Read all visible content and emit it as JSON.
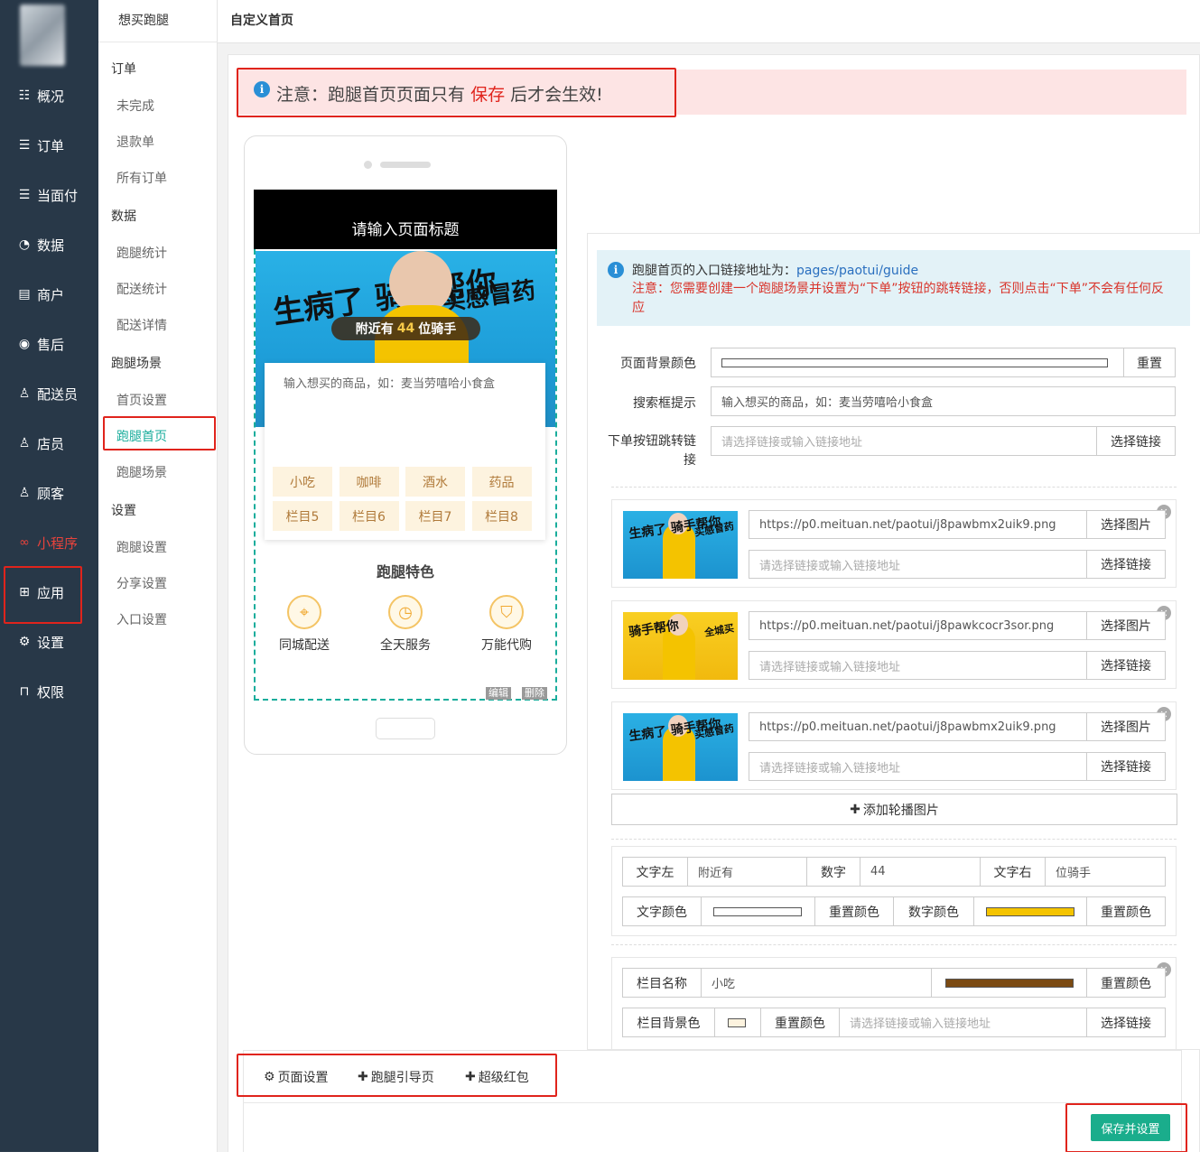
{
  "nav": {
    "items": [
      {
        "label": "概况",
        "icon": "dashboard-icon",
        "glyph": "☷"
      },
      {
        "label": "订单",
        "icon": "order-icon",
        "glyph": "☰"
      },
      {
        "label": "当面付",
        "icon": "face-pay-icon",
        "glyph": "☰"
      },
      {
        "label": "数据",
        "icon": "chart-icon",
        "glyph": "◔"
      },
      {
        "label": "商户",
        "icon": "shop-icon",
        "glyph": "▤"
      },
      {
        "label": "售后",
        "icon": "after-sale-icon",
        "glyph": "◉"
      },
      {
        "label": "配送员",
        "icon": "courier-icon",
        "glyph": "♙"
      },
      {
        "label": "店员",
        "icon": "clerk-icon",
        "glyph": "♙"
      },
      {
        "label": "顾客",
        "icon": "customer-icon",
        "glyph": "♙"
      },
      {
        "label": "小程序",
        "icon": "mini-program-icon",
        "glyph": "∞"
      },
      {
        "label": "应用",
        "icon": "apps-icon",
        "glyph": "⊞"
      },
      {
        "label": "设置",
        "icon": "settings-icon",
        "glyph": "⚙"
      },
      {
        "label": "权限",
        "icon": "lock-icon",
        "glyph": "⊓"
      }
    ]
  },
  "sub": {
    "title": "想买跑腿",
    "groups": [
      {
        "heading": "订单",
        "items": [
          "未完成",
          "退款单",
          "所有订单"
        ]
      },
      {
        "heading": "数据",
        "items": [
          "跑腿统计",
          "配送统计",
          "配送详情"
        ]
      },
      {
        "heading": "跑腿场景",
        "items": [
          "首页设置",
          "跑腿首页",
          "跑腿场景"
        ]
      },
      {
        "heading": "设置",
        "items": [
          "跑腿设置",
          "分享设置",
          "入口设置"
        ]
      }
    ]
  },
  "page_title": "自定义首页",
  "notice": {
    "prefix": "注意：跑腿首页页面只有",
    "highlight": "保存",
    "suffix": "后才会生效!"
  },
  "phone": {
    "header_title": "请输入页面标题",
    "banner": {
      "text_left": "生病了 骑手帮你",
      "text_right": "买感冒药",
      "pill_prefix": "附近有",
      "pill_number": "44",
      "pill_suffix": "位骑手"
    },
    "search_text": "输入想买的商品，如：麦当劳嘻哈小食盒",
    "categories": [
      "小吃",
      "咖啡",
      "酒水",
      "药品",
      "栏目5",
      "栏目6",
      "栏目7",
      "栏目8"
    ],
    "features_title": "跑腿特色",
    "features": [
      {
        "label": "同城配送",
        "icon": "location-icon"
      },
      {
        "label": "全天服务",
        "icon": "clock-icon"
      },
      {
        "label": "万能代购",
        "icon": "shopping-bag-icon"
      }
    ],
    "edit_label": "编辑",
    "delete_label": "删除"
  },
  "info": {
    "line1_prefix": "跑腿首页的入口链接地址为：",
    "line1_link": "pages/paotui/guide",
    "line2": "注意：您需要创建一个跑腿场景并设置为“下单”按钮的跳转链接，否则点击“下单”不会有任何反应"
  },
  "form": {
    "bg_label": "页面背景颜色",
    "reset_label": "重置",
    "search_label": "搜索框提示",
    "search_value": "输入想买的商品，如：麦当劳嘻哈小食盒",
    "order_label": "下单按钮跳转链接",
    "link_placeholder": "请选择链接或输入链接地址",
    "choose_link": "选择链接"
  },
  "slides": [
    {
      "url": "https://p0.meituan.net/paotui/j8pawbmx2uik9.png",
      "theme": "blue",
      "t1": "生病了 骑手帮你",
      "t2": "买感冒药"
    },
    {
      "url": "https://p0.meituan.net/paotui/j8pawkcocr3sor.png",
      "theme": "yellow",
      "t1": "骑手帮你",
      "t2": "全城买"
    },
    {
      "url": "https://p0.meituan.net/paotui/j8pawbmx2uik9.png",
      "theme": "blue",
      "t1": "生病了 骑手帮你",
      "t2": "买感冒药"
    }
  ],
  "slide_choose_image": "选择图片",
  "add_slide_label": "添加轮播图片",
  "rider_count": {
    "text_left_label": "文字左",
    "text_left_value": "附近有",
    "number_label": "数字",
    "number_value": "44",
    "text_right_label": "文字右",
    "text_right_value": "位骑手",
    "text_color_label": "文字颜色",
    "reset_color": "重置颜色",
    "number_color_label": "数字颜色",
    "text_color": "#ffffff",
    "number_color": "#f5c400"
  },
  "column": {
    "name_label": "栏目名称",
    "name_value": "小吃",
    "name_color": "#7b4a12",
    "bg_label": "栏目背景色",
    "bg_color": "#fdf3df"
  },
  "bottom": {
    "tabs": [
      {
        "label": "页面设置",
        "icon": "gear-icon",
        "glyph": "⚙"
      },
      {
        "label": "跑腿引导页",
        "icon": "plus-icon",
        "glyph": "✚"
      },
      {
        "label": "超级红包",
        "icon": "plus-icon",
        "glyph": "✚"
      }
    ],
    "save_label": "保存并设置"
  },
  "colors": {
    "accent": "#1aad9c",
    "nav_bg": "#283848",
    "alert": "#e0241c"
  }
}
